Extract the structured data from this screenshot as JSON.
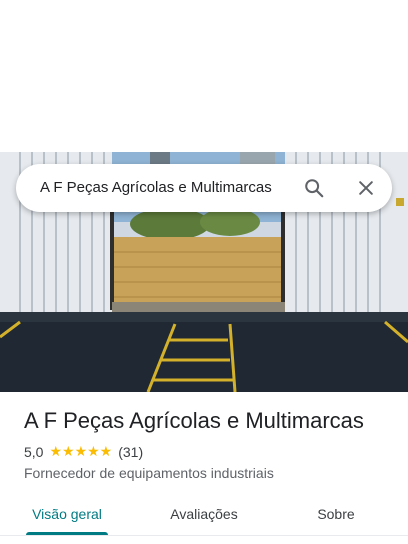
{
  "search": {
    "query": "A F Peças Agrícolas e Multimarcas",
    "search_icon": "search-icon",
    "close_icon": "close-icon"
  },
  "place": {
    "name": "A F Peças Agrícolas e Multimarcas",
    "rating": "5,0",
    "stars": "★★★★★",
    "review_count": "(31)",
    "category": "Fornecedor de equipamentos industriais"
  },
  "tabs": [
    {
      "label": "Visão geral",
      "active": true
    },
    {
      "label": "Avaliações",
      "active": false
    },
    {
      "label": "Sobre",
      "active": false
    }
  ],
  "colors": {
    "accent": "#007b83",
    "star": "#fbbc04"
  }
}
